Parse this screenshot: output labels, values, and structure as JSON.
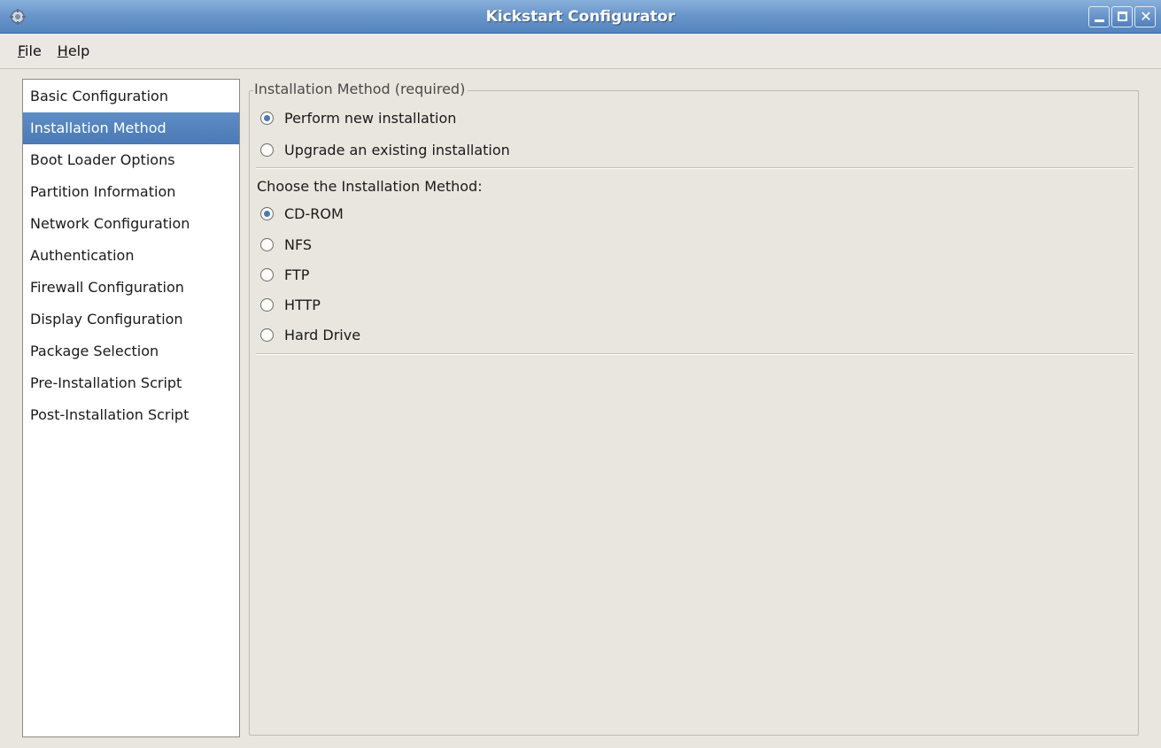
{
  "window": {
    "title": "Kickstart Configurator"
  },
  "menubar": {
    "items": [
      {
        "mnemonic": "F",
        "rest": "ile"
      },
      {
        "mnemonic": "H",
        "rest": "elp"
      }
    ]
  },
  "sidebar": {
    "items": [
      {
        "label": "Basic Configuration",
        "selected": false
      },
      {
        "label": "Installation Method",
        "selected": true
      },
      {
        "label": "Boot Loader Options",
        "selected": false
      },
      {
        "label": "Partition Information",
        "selected": false
      },
      {
        "label": "Network Configuration",
        "selected": false
      },
      {
        "label": "Authentication",
        "selected": false
      },
      {
        "label": "Firewall Configuration",
        "selected": false
      },
      {
        "label": "Display Configuration",
        "selected": false
      },
      {
        "label": "Package Selection",
        "selected": false
      },
      {
        "label": "Pre-Installation Script",
        "selected": false
      },
      {
        "label": "Post-Installation Script",
        "selected": false
      }
    ]
  },
  "panel": {
    "legend": "Installation Method (required)",
    "install_type": {
      "options": [
        {
          "label": "Perform new installation",
          "checked": true
        },
        {
          "label": "Upgrade an existing installation",
          "checked": false
        }
      ]
    },
    "method_label": "Choose the Installation Method:",
    "method": {
      "options": [
        {
          "label": "CD-ROM",
          "checked": true
        },
        {
          "label": "NFS",
          "checked": false
        },
        {
          "label": "FTP",
          "checked": false
        },
        {
          "label": "HTTP",
          "checked": false
        },
        {
          "label": "Hard Drive",
          "checked": false
        }
      ]
    }
  },
  "colors": {
    "titlebar": "#5584bd",
    "selection": "#4a79b5",
    "window_bg": "#e9e6e0"
  }
}
